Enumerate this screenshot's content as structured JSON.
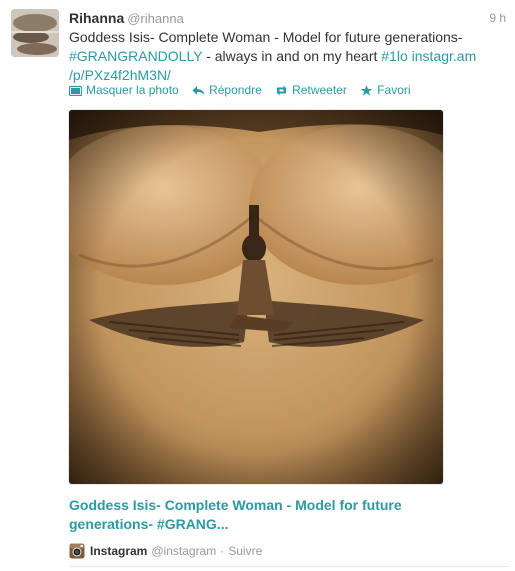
{
  "tweet": {
    "author_name": "Rihanna",
    "author_handle": "@rihanna",
    "time": "9 h",
    "text_plain_1": "Goddess Isis- Complete Woman - Model for future generations-",
    "hashtag_1": "#GRANGRANDOLLY",
    "text_plain_2": " - always in and on my heart ",
    "hashtag_2": "#1lo",
    "link_1": " instagr.am",
    "link_2": "/p/PXz4f2hM3N/"
  },
  "actions": {
    "hide_photo": "Masquer la photo",
    "reply": "Répondre",
    "retweet": "Retweeter",
    "favorite": "Favori"
  },
  "card": {
    "title": "Goddess Isis- Complete Woman - Model for future generations- #GRANG...",
    "source_name": "Instagram",
    "source_handle": "@instagram",
    "separator": "·",
    "follow_label": "Suivre"
  },
  "colors": {
    "link": "#2b9aa4",
    "muted": "#999999",
    "text": "#333333"
  },
  "icons": {
    "photo": "photo-icon",
    "reply": "reply-icon",
    "retweet": "retweet-icon",
    "favorite": "star-icon",
    "instagram": "instagram-icon"
  }
}
